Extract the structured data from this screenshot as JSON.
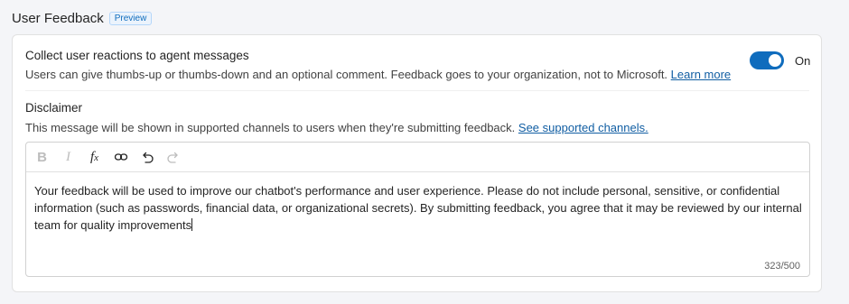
{
  "section": {
    "title": "User Feedback",
    "badge": "Preview"
  },
  "reactions": {
    "title": "Collect user reactions to agent messages",
    "description": "Users can give thumbs-up or thumbs-down and an optional comment. Feedback goes to your organization, not to Microsoft.",
    "link": "Learn more",
    "toggle_state": "On",
    "toggle_on": true,
    "accent_color": "#0f6cbd"
  },
  "disclaimer": {
    "title": "Disclaimer",
    "description": "This message will be shown in supported channels to users when they're submitting feedback.",
    "link": "See supported channels."
  },
  "editor": {
    "toolbar": [
      {
        "name": "bold-icon",
        "glyph": "B",
        "enabled": false
      },
      {
        "name": "italic-icon",
        "glyph": "I",
        "enabled": false
      },
      {
        "name": "formula-icon",
        "glyph": "fx",
        "enabled": true
      },
      {
        "name": "link-icon",
        "glyph": "link",
        "enabled": true
      },
      {
        "name": "undo-icon",
        "glyph": "undo",
        "enabled": true
      },
      {
        "name": "redo-icon",
        "glyph": "redo",
        "enabled": false
      }
    ],
    "text": "Your feedback will be used to improve our chatbot's performance and user experience. Please do not include personal, sensitive, or confidential information (such as passwords, financial data, or organizational secrets). By submitting feedback, you agree that it may be reviewed by our internal team for quality improvements",
    "counter": "323/500"
  }
}
